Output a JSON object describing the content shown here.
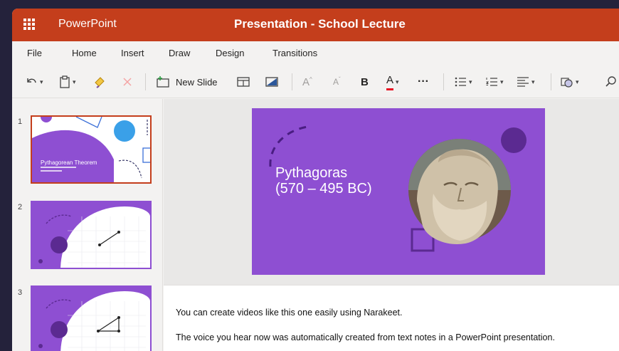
{
  "titlebar": {
    "app_name": "PowerPoint",
    "document_title": "Presentation - School Lecture",
    "color": "#c43e1c"
  },
  "menu": {
    "items": [
      "File",
      "Home",
      "Insert",
      "Draw",
      "Design",
      "Transitions"
    ]
  },
  "toolbar": {
    "new_slide_label": "New Slide",
    "bold_label": "B",
    "font_grow_label": "A",
    "font_shrink_label": "A",
    "font_color_label": "A",
    "more_label": "···",
    "font_color_accent": "#e81123"
  },
  "thumbnails": [
    {
      "number": "1",
      "title": "Pythagorean Theorem"
    },
    {
      "number": "2"
    },
    {
      "number": "3"
    }
  ],
  "slide": {
    "title_line1": "Pythagoras",
    "title_line2": "(570 – 495 BC)",
    "background": "#8e4fd2"
  },
  "notes": {
    "line1": "You can create videos like this one easily using Narakeet.",
    "line2": "The voice you hear now was automatically created from text notes in a PowerPoint presentation."
  }
}
